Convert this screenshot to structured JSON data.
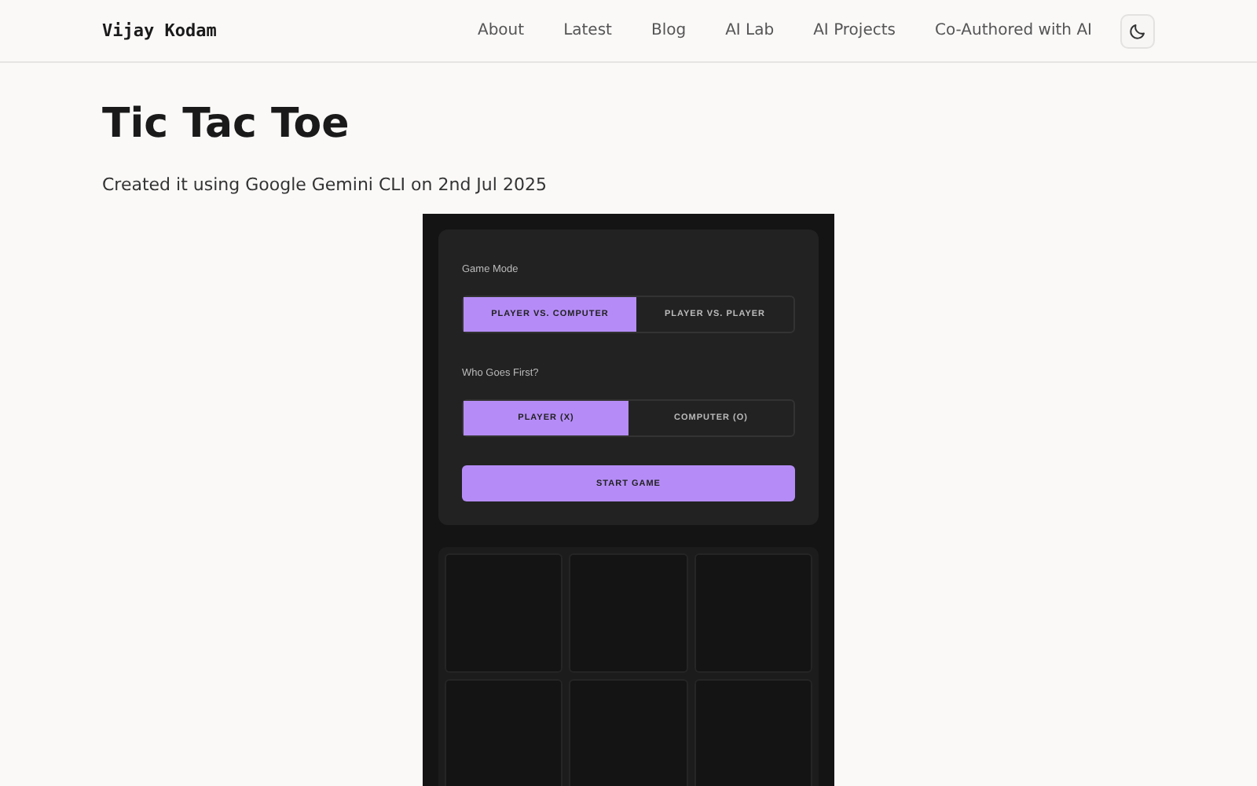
{
  "site_title": "Vijay Kodam",
  "nav": [
    {
      "label": "About"
    },
    {
      "label": "Latest"
    },
    {
      "label": "Blog"
    },
    {
      "label": "AI Lab"
    },
    {
      "label": "AI Projects"
    },
    {
      "label": "Co-Authored with AI"
    }
  ],
  "page": {
    "title": "Tic Tac Toe",
    "subtitle": "Created it using Google Gemini CLI on 2nd Jul 2025"
  },
  "game": {
    "settings": [
      {
        "label": "Game Mode",
        "options": [
          {
            "label": "PLAYER VS. COMPUTER",
            "selected": true
          },
          {
            "label": "PLAYER VS. PLAYER",
            "selected": false
          }
        ]
      },
      {
        "label": "Who Goes First?",
        "options": [
          {
            "label": "PLAYER (X)",
            "selected": true
          },
          {
            "label": "COMPUTER (O)",
            "selected": false
          }
        ]
      }
    ],
    "start_button": "START GAME"
  }
}
